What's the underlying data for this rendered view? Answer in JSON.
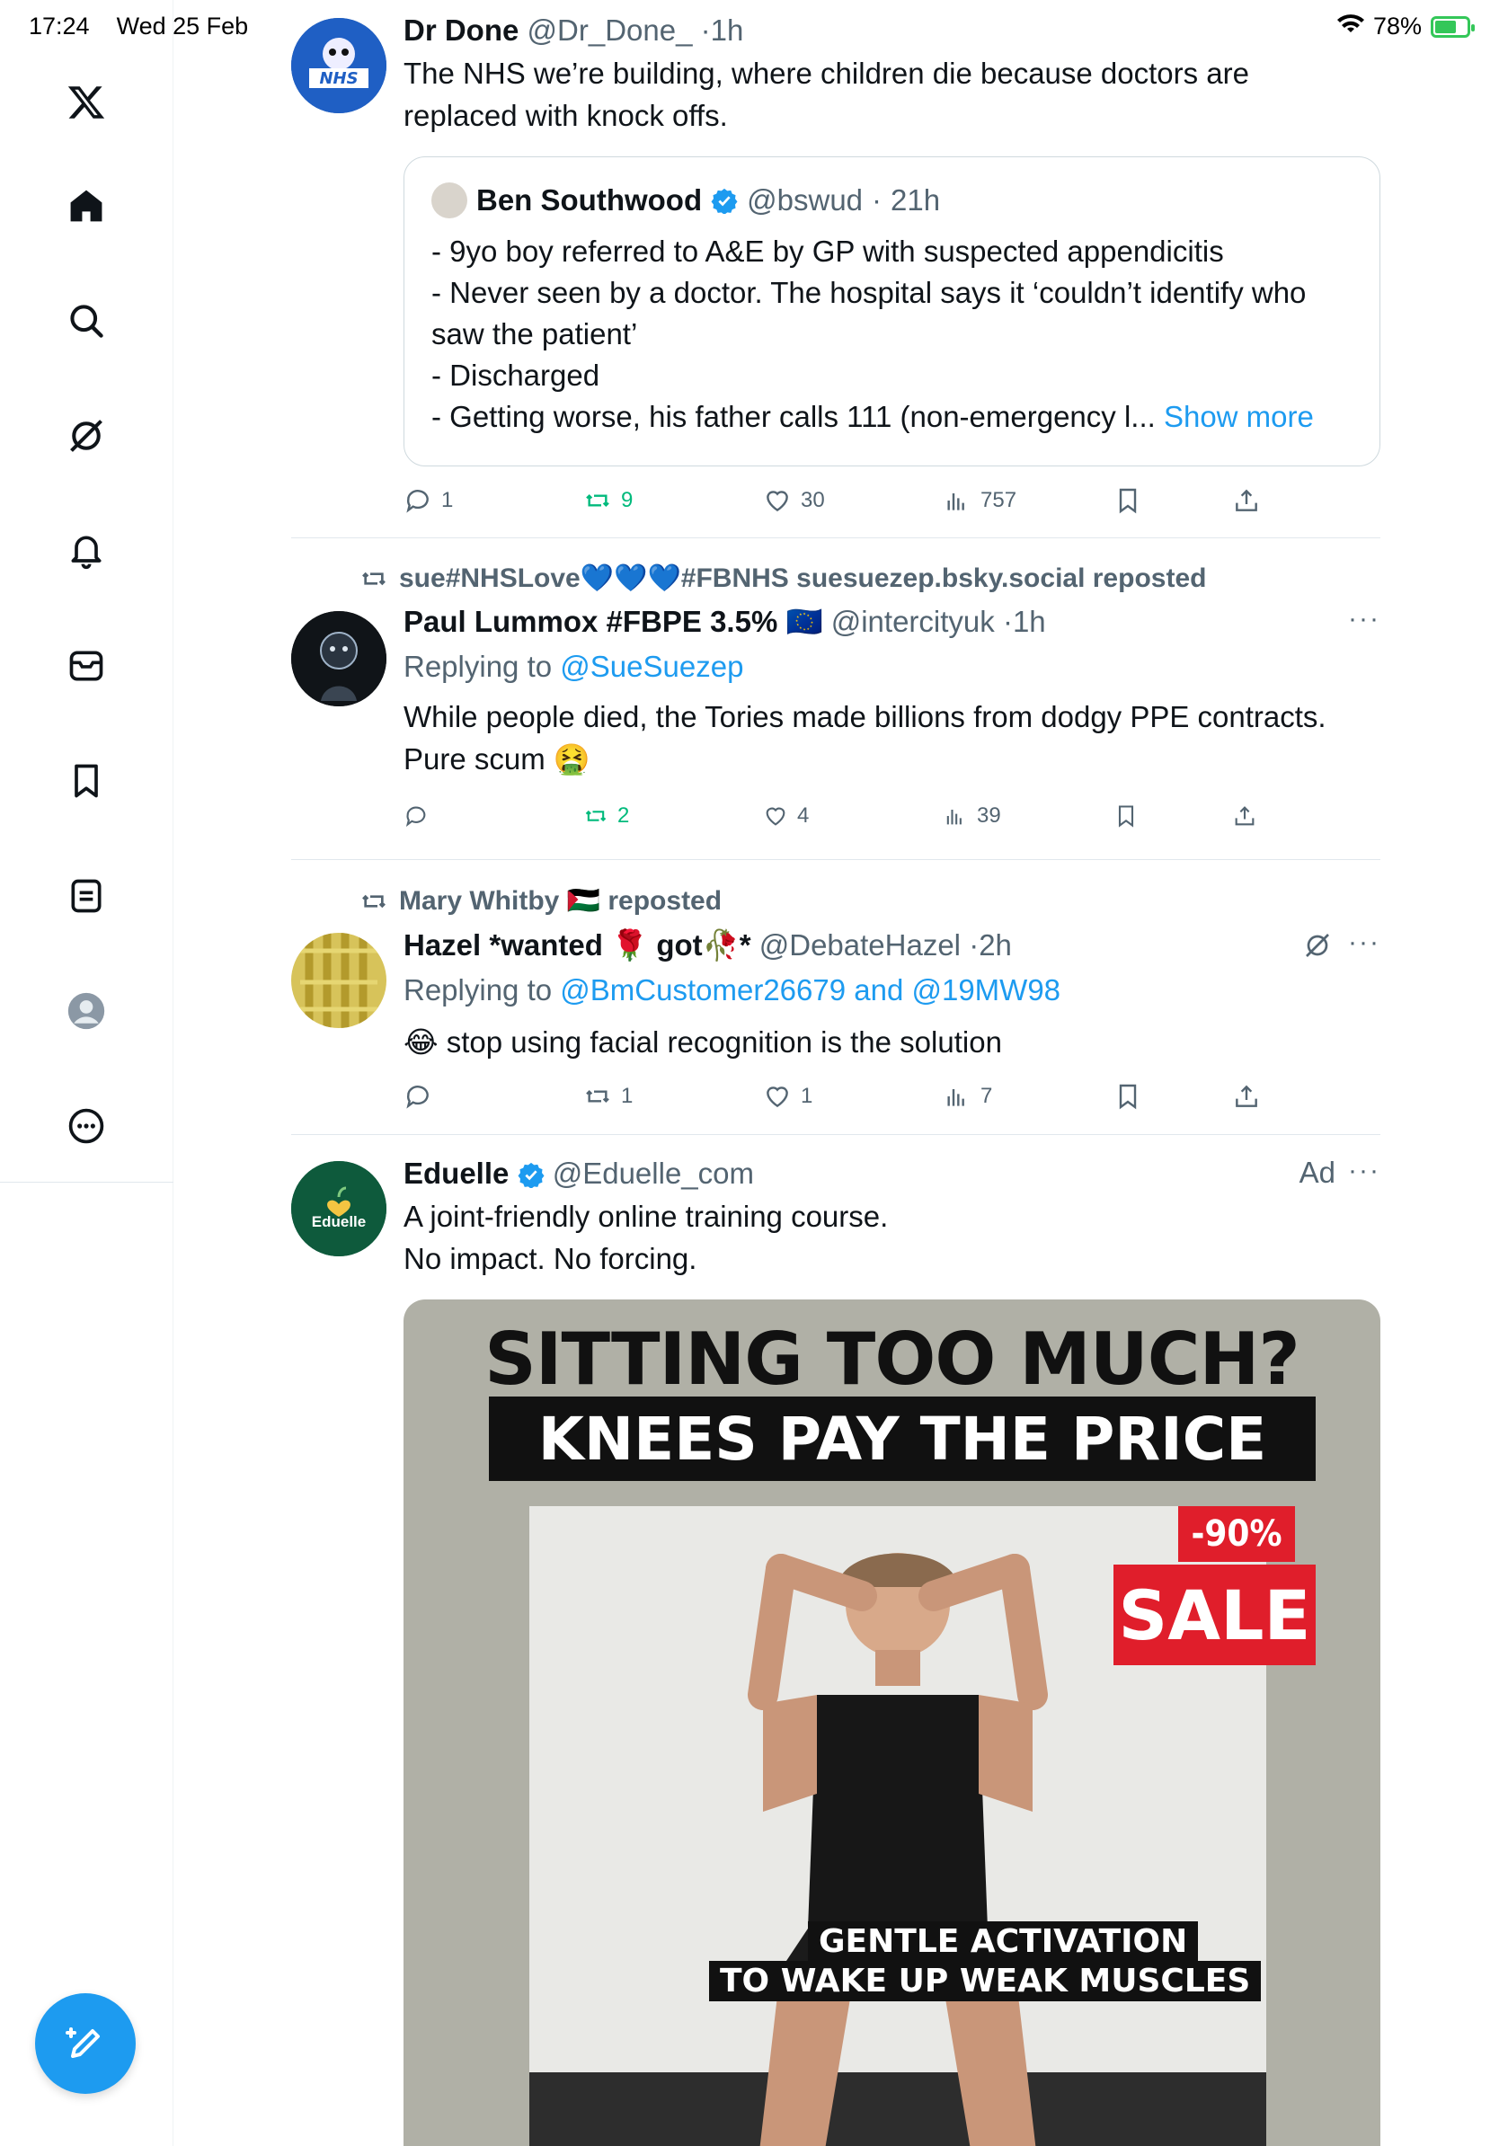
{
  "status_bar": {
    "time": "17:24",
    "date": "Wed 25 Feb",
    "battery": "78%"
  },
  "sidebar": {
    "items": [
      "x-logo",
      "home",
      "explore",
      "grok",
      "notifications",
      "messages",
      "bookmarks",
      "lists",
      "profile",
      "more"
    ]
  },
  "tweets": [
    {
      "name": "Dr Done",
      "handle": "@Dr_Done_",
      "time": "1h",
      "text_line1": "The NHS we’re building, where children die because doctors are",
      "text_line2": "replaced with knock offs.",
      "quote": {
        "name": "Ben Southwood",
        "handle": "@bswud",
        "time": "21h",
        "line1": "- 9yo boy referred to A&E by GP with suspected appendicitis",
        "line2": "- Never seen by a doctor. The hospital says it ‘couldn’t identify who",
        "line3": "saw the patient’",
        "line4": "- Discharged",
        "line5": "- Getting worse, his father calls 111 (non-emergency l...",
        "show_more": "Show more"
      },
      "replies": "1",
      "reposts": "9",
      "likes": "30",
      "views": "757"
    },
    {
      "repost_by": "sue#NHSLove💙💙💙#FBNHS suesuezep.bsky.social reposted",
      "name": "Paul Lummox #FBPE 3.5% 🇪🇺",
      "handle": "@intercityuk",
      "time": "1h",
      "reply_prefix": "Replying to",
      "reply_to": "@SueSuezep",
      "text_line1": "While people died, the Tories made billions from dodgy PPE contracts.",
      "text_line2": "Pure scum 🤮",
      "replies": "",
      "reposts": "2",
      "likes": "4",
      "views": "39"
    },
    {
      "repost_by": "Mary Whitby 🇵🇸 reposted",
      "name": "Hazel *wanted 🌹 got🥀*",
      "handle": "@DebateHazel",
      "time": "2h",
      "reply_prefix": "Replying to",
      "reply_to": "@BmCustomer26679 and @19MW98",
      "text_line1": "😂 stop using facial recognition is the solution",
      "replies": "",
      "reposts": "1",
      "likes": "1",
      "views": "7"
    },
    {
      "name": "Eduelle",
      "handle": "@Eduelle_com",
      "ad_label": "Ad",
      "avatar_text": "Eduelle",
      "text_line1": "A joint-friendly online training course.",
      "text_line2": "No impact. No forcing.",
      "ad_image": {
        "headline": "SITTING TOO MUCH?",
        "subheadline": "KNEES PAY THE PRICE",
        "discount": "-90%",
        "sale": "SALE",
        "caption1": "GENTLE ACTIVATION",
        "caption2": "TO WAKE UP WEAK MUSCLES"
      }
    }
  ],
  "colors": {
    "accent": "#1d9bf0",
    "repost_green": "#00ba7c",
    "muted": "#536471",
    "sale_red": "#e01e2b"
  }
}
